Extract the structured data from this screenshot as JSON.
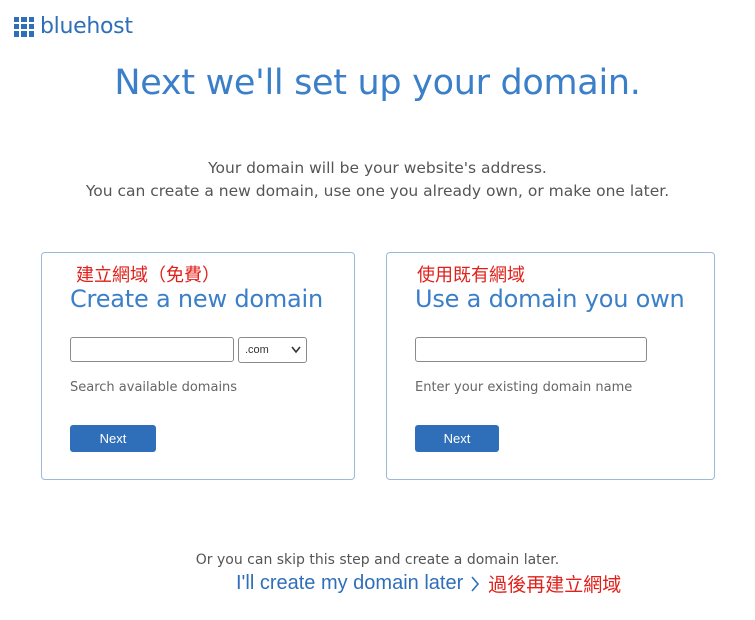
{
  "brand": {
    "name": "bluehost",
    "color": "#2f6fba"
  },
  "headline": "Next we'll set up your domain.",
  "subtitle": {
    "line1": "Your domain will be your website's address.",
    "line2": "You can create a new domain, use one you already own, or make one later."
  },
  "new_domain": {
    "annotation": "建立網域（免費）",
    "title": "Create a new domain",
    "input_value": "",
    "tld_selected": ".com",
    "hint": "Search available domains",
    "button": "Next"
  },
  "existing_domain": {
    "annotation": "使用既有網域",
    "title": "Use a domain you own",
    "input_value": "",
    "hint": "Enter your existing domain name",
    "button": "Next"
  },
  "skip": {
    "text": "Or you can skip this step and create a domain later.",
    "link": "I'll create my domain later",
    "annotation": "過後再建立網域"
  },
  "colors": {
    "accent": "#3b7fc9",
    "button": "#2f6fba",
    "annotation": "#e0201a",
    "card_border": "#9db9d9"
  }
}
